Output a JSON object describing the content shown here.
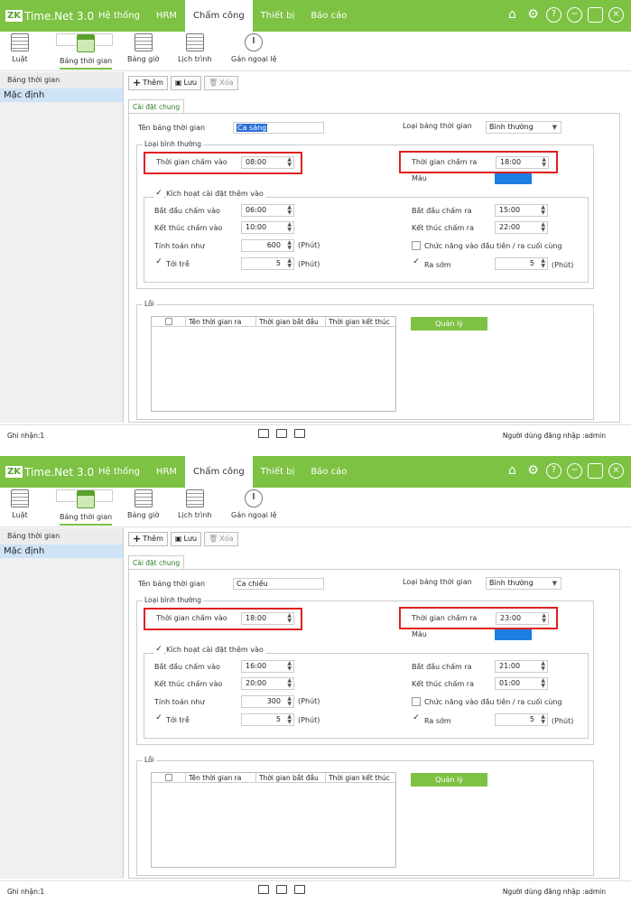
{
  "app": {
    "logo": "ZK",
    "title": "Time.Net 3.0"
  },
  "menu": [
    "Hệ thống",
    "HRM",
    "Chấm công",
    "Thiết bị",
    "Báo cáo"
  ],
  "ribbon": [
    "Luật",
    "Bảng thời gian",
    "Bảng giờ",
    "Lịch trình",
    "Gán ngoại lệ"
  ],
  "sidebar": {
    "header": "Bảng thời gian",
    "item": "Mặc định"
  },
  "toolbar": {
    "add": "Thêm",
    "save": "Lưu",
    "delete": "Xóa"
  },
  "tab": "Cài đặt chung",
  "labels": {
    "table_name": "Tên bảng thời gian",
    "table_type": "Loại bảng thời gian",
    "normal_type": "Loại bình thường",
    "check_in_time": "Thời gian chấm vào",
    "check_out_time": "Thời gian chấm ra",
    "color": "Màu",
    "activate_extra": "Kích hoạt cài đặt thêm vào",
    "start_check_in": "Bắt đầu chấm vào",
    "end_check_in": "Kết thúc chấm vào",
    "start_check_out": "Bắt đầu chấm ra",
    "end_check_out": "Kết thúc chấm ra",
    "count_as": "Tính toán như",
    "first_last": "Chức năng vào đầu tiên / ra cuối cùng",
    "late": "Tới trễ",
    "early": "Ra sớm",
    "minutes": "(Phút)",
    "errors": "Lỗi",
    "manage": "Quản lý",
    "col_name": "Tên thời gian ra",
    "col_start": "Thời gian bắt đầu",
    "col_end": "Thời gian kết thúc"
  },
  "status": {
    "records": "Ghi nhận:1",
    "user": "Người dùng đăng nhập :admin"
  },
  "colors": {
    "accent": "#7dc243",
    "swatch": "#1e7de0",
    "highlight": "#e02020"
  },
  "frames": [
    {
      "name": "Ca sáng",
      "type": "Bình thường",
      "check_in": "08:00",
      "check_out": "18:00",
      "start_in": "06:00",
      "end_in": "10:00",
      "start_out": "15:00",
      "end_out": "22:00",
      "count": "600",
      "late": "5",
      "early": "5"
    },
    {
      "name": "Ca chiều",
      "type": "Bình thường",
      "check_in": "18:00",
      "check_out": "23:00",
      "start_in": "16:00",
      "end_in": "20:00",
      "start_out": "21:00",
      "end_out": "01:00",
      "count": "300",
      "late": "5",
      "early": "5"
    }
  ]
}
